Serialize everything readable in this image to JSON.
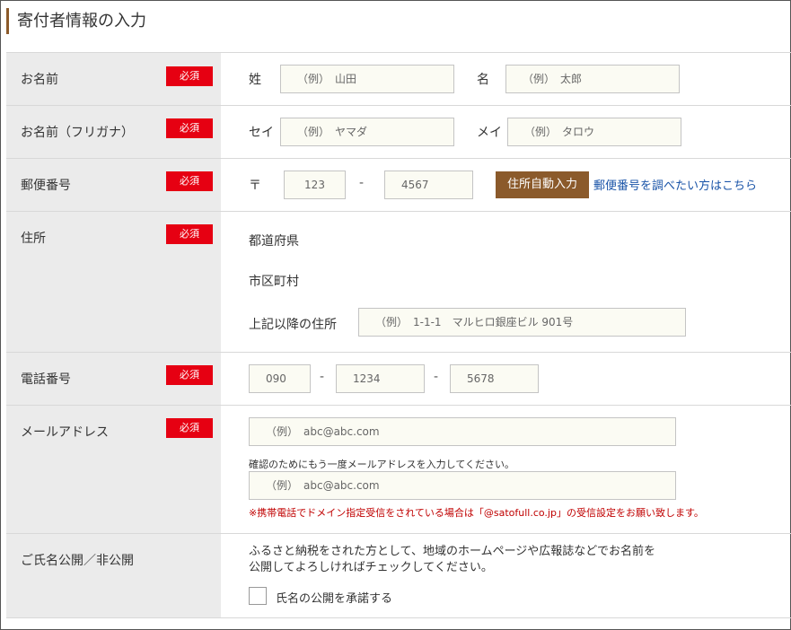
{
  "header": {
    "title": "寄付者情報の入力"
  },
  "required_badge": "必須",
  "name_row": {
    "label": "お名前",
    "sei_label": "姓",
    "sei_placeholder": "（例）　山田",
    "mei_label": "名",
    "mei_placeholder": "（例）　太郎"
  },
  "kana_row": {
    "label": "お名前（フリガナ）",
    "sei_label": "セイ",
    "sei_placeholder": "（例）　ヤマダ",
    "mei_label": "メイ",
    "mei_placeholder": "（例）　タロウ"
  },
  "postal_row": {
    "label": "郵便番号",
    "mark": "〒",
    "first_placeholder": "123",
    "separator": "-",
    "second_placeholder": "4567",
    "auto_button": "住所自動入力",
    "lookup_link": "郵便番号を調べたい方はこちら"
  },
  "address_row": {
    "label": "住所",
    "prefecture_label": "都道府県",
    "city_label": "市区町村",
    "street_label": "上記以降の住所",
    "street_placeholder": "（例）　1-1-1　マルヒロ銀座ビル 901号"
  },
  "phone_row": {
    "label": "電話番号",
    "first_placeholder": "090",
    "separator": "-",
    "second_placeholder": "1234",
    "third_placeholder": "5678"
  },
  "email_row": {
    "label": "メールアドレス",
    "placeholder": "（例）　abc@abc.com",
    "confirm_note": "確認のためにもう一度メールアドレスを入力してください。",
    "confirm_placeholder": "（例）　abc@abc.com",
    "warning": "※携帯電話でドメイン指定受信をされている場合は「@satofull.co.jp」の受信設定をお願い致します。"
  },
  "publish_row": {
    "label": "ご氏名公開／非公開",
    "line1": "ふるさと納税をされた方として、地域のホームページや広報誌などでお名前を",
    "line2": "公開してよろしければチェックしてください。",
    "checkbox_label": "氏名の公開を承諾する"
  },
  "colors": {
    "required": "#e60012",
    "accent": "#8b5a2b",
    "link": "#1a54a8",
    "warning": "#c00000",
    "label_bg": "#ebebeb",
    "input_bg": "#fbfbf3"
  }
}
